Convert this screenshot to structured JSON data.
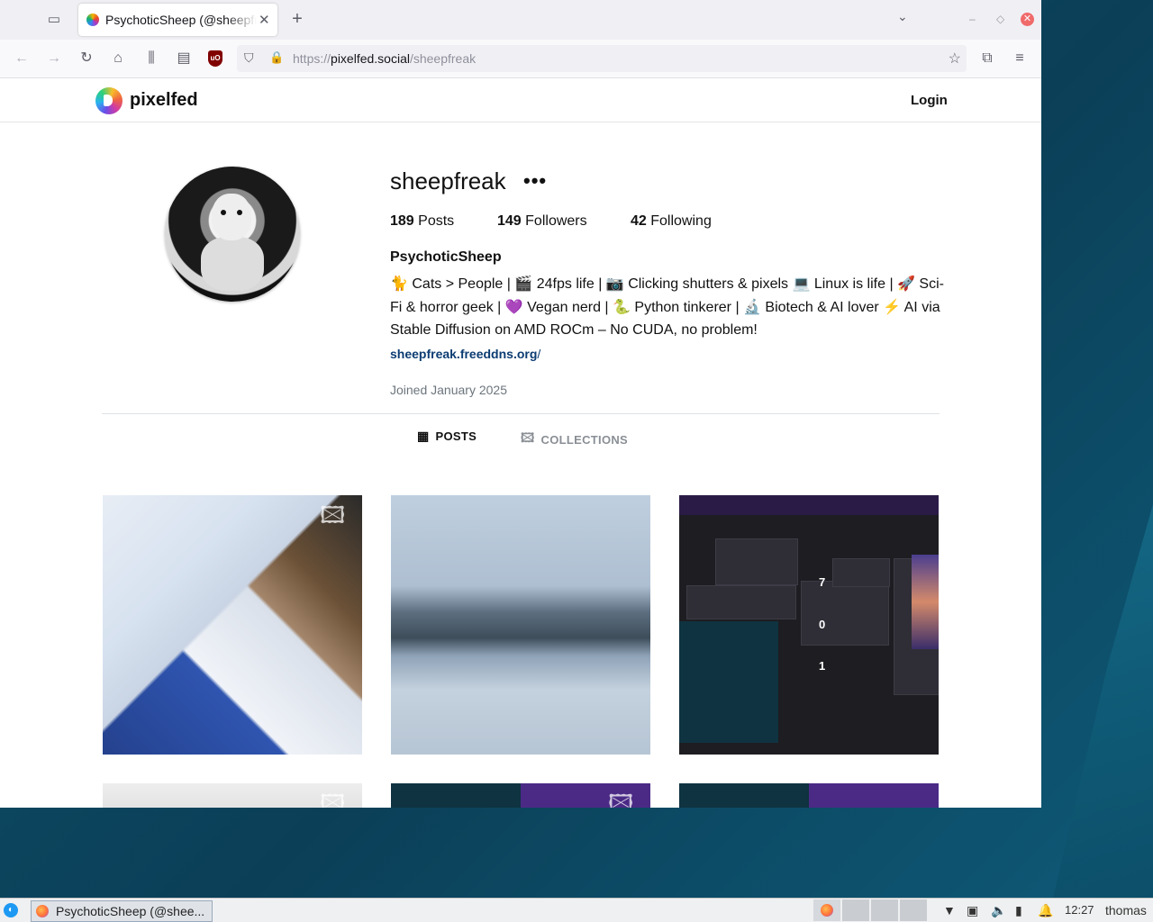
{
  "browser": {
    "tab_title": "PsychoticSheep (@sheepfreak) - Pixelfed",
    "url_prefix": "https://",
    "url_host": "pixelfed.social",
    "url_path": "/sheepfreak"
  },
  "site": {
    "brand": "pixelfed",
    "login": "Login"
  },
  "profile": {
    "username": "sheepfreak",
    "more": "•••",
    "posts_count": "189",
    "posts_label": "Posts",
    "followers_count": "149",
    "followers_label": "Followers",
    "following_count": "42",
    "following_label": "Following",
    "display_name": "PsychoticSheep",
    "bio": "🐈 Cats > People | 🎬 24fps life | 📷 Clicking shutters & pixels 💻 Linux is life | 🚀 Sci-Fi & horror geek | 💜 Vegan nerd | 🐍 Python tinkerer | 🔬 Biotech & AI lover ⚡ AI via Stable Diffusion on AMD ROCm – No CUDA, no problem!",
    "website": "sheepfreak.freeddns.org",
    "website_slash": "/",
    "joined": "Joined January 2025"
  },
  "tabs": {
    "posts": "POSTS",
    "collections": "COLLECTIONS"
  },
  "grid": {
    "post3_labels": [
      "7",
      "0",
      "1"
    ]
  },
  "taskbar": {
    "task_title": "PsychoticSheep (@shee...",
    "clock": "12:27",
    "user": "thomas"
  }
}
